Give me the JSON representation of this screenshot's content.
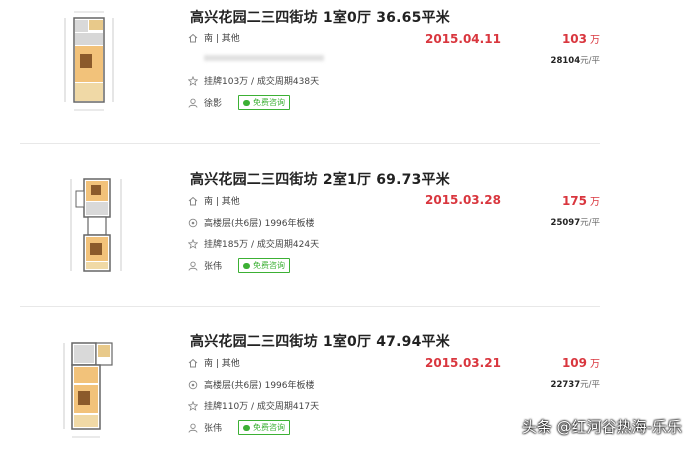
{
  "listings": [
    {
      "title": "高兴花园二三四街坊 1室0厅 36.65平米",
      "orientation": "南 | 其他",
      "floor_info": "",
      "listing_info": "挂牌103万 / 成交周期438天",
      "agent": "徐影",
      "consult_label": "免费咨询",
      "deal_date": "2015.04.11",
      "price": "103",
      "price_unit": "万",
      "unit_price_value": "28104",
      "unit_price_suffix": "元/平"
    },
    {
      "title": "高兴花园二三四街坊 2室1厅 69.73平米",
      "orientation": "南 | 其他",
      "floor_info": "高楼层(共6层) 1996年板楼",
      "listing_info": "挂牌185万 / 成交周期424天",
      "agent": "张伟",
      "consult_label": "免费咨询",
      "deal_date": "2015.03.28",
      "price": "175",
      "price_unit": "万",
      "unit_price_value": "25097",
      "unit_price_suffix": "元/平"
    },
    {
      "title": "高兴花园二三四街坊 1室0厅 47.94平米",
      "orientation": "南 | 其他",
      "floor_info": "高楼层(共6层) 1996年板楼",
      "listing_info": "挂牌110万 / 成交周期417天",
      "agent": "张伟",
      "consult_label": "免费咨询",
      "deal_date": "2015.03.21",
      "price": "109",
      "price_unit": "万",
      "unit_price_value": "22737",
      "unit_price_suffix": "元/平"
    }
  ],
  "watermark": "头条 @红河谷热海-乐乐",
  "icons": {
    "orientation": "home-icon",
    "floor": "location-pin-icon",
    "listing": "star-icon",
    "agent": "user-icon",
    "consult": "chat-bubble-icon"
  },
  "colors": {
    "accent_red": "#d9363e",
    "consult_green": "#3cb034"
  }
}
